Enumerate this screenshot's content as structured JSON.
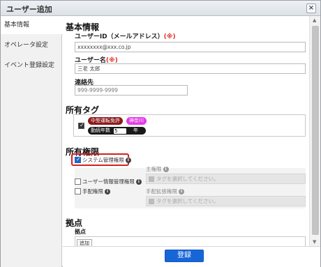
{
  "dialog": {
    "title": "ユーザー追加",
    "close_icon": "close-icon"
  },
  "sidebar": {
    "items": [
      {
        "label": "基本情報",
        "active": true
      },
      {
        "label": "オペレータ設定",
        "active": false
      },
      {
        "label": "イベント登録設定",
        "active": false
      }
    ]
  },
  "basic": {
    "heading": "基本情報",
    "user_id_label": "ユーザーID（メールアドレス）",
    "user_id_value": "xxxxxxxx@xxx.co.jp",
    "user_name_label": "ユーザー名",
    "user_name_value": "三老 太郎",
    "contact_label": "連絡先",
    "contact_placeholder": "999-9999-9999",
    "required_mark": "(※)"
  },
  "tags": {
    "heading": "所有タグ",
    "items": [
      "中型運転免許",
      "神奈川"
    ],
    "years_label": "勤続年数",
    "years_value": "5",
    "years_unit": "年"
  },
  "permissions": {
    "heading": "所有権限",
    "system_admin_label": "システム管理権限",
    "user_info_label": "ユーザー情報管理権限",
    "dispatch_label": "手配権限",
    "primary_label": "主権限",
    "primary_placeholder": "タグを選択してください。",
    "dispatch_ext_label": "手配拡張権限",
    "dispatch_ext_placeholder": "タグを選択してください。"
  },
  "base": {
    "heading": "拠点",
    "sub_label": "拠点",
    "add_label": "追加"
  },
  "footer": {
    "submit_label": "登録"
  },
  "colors": {
    "accent": "#1766d8",
    "required": "#e0302a",
    "highlight": "#d6201e"
  }
}
